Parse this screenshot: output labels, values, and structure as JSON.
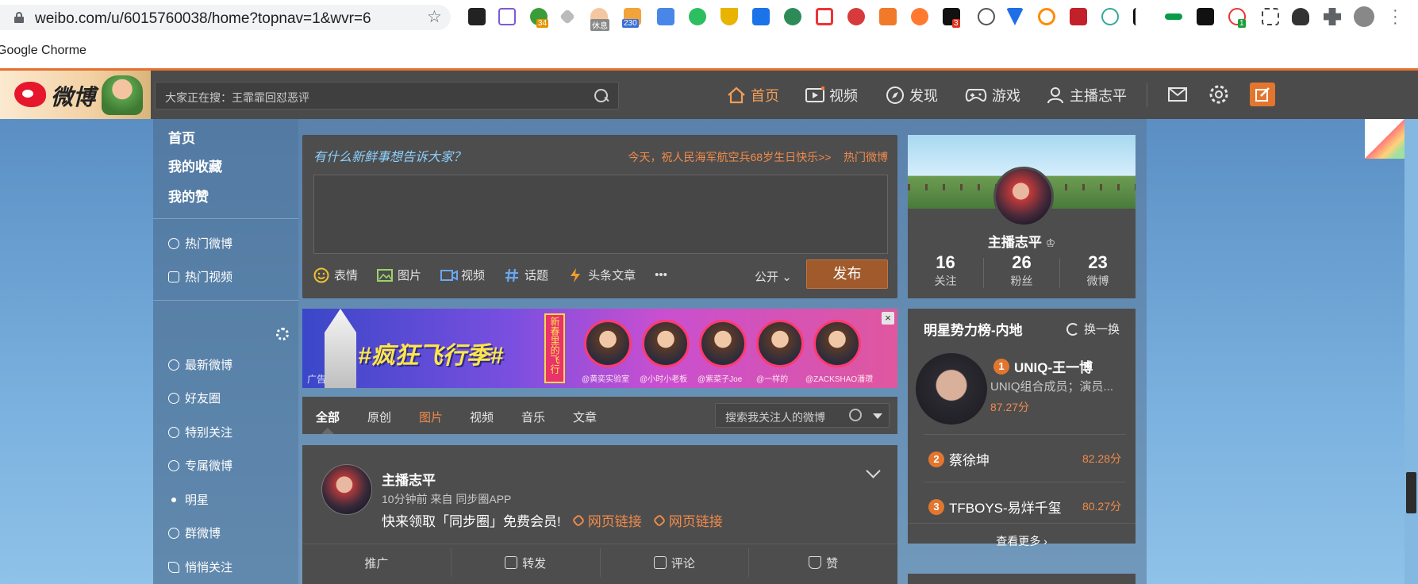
{
  "browser": {
    "url": "weibo.com/u/6015760038/home?topnav=1&wvr=6",
    "bookmark": "Google Chorme",
    "ext_badges": [
      "34",
      "休息",
      "230",
      "3",
      "1"
    ]
  },
  "nav": {
    "logo_text": "微博",
    "search_placeholder": "大家正在搜：王霏霏回怼恶评",
    "items": [
      {
        "label": "首页",
        "icon": "home-icon"
      },
      {
        "label": "视频",
        "icon": "video-icon"
      },
      {
        "label": "发现",
        "icon": "compass-icon"
      },
      {
        "label": "游戏",
        "icon": "gamepad-icon"
      },
      {
        "label": "主播志平",
        "icon": "user-icon"
      }
    ],
    "colors": {
      "bar": "#4b4b4b",
      "active": "#f29d56",
      "accent": "#e2762f"
    }
  },
  "sidebar": {
    "main_items": [
      "首页",
      "我的收藏",
      "我的赞"
    ],
    "sub_items": [
      "热门微博",
      "热门视频"
    ],
    "group_items": [
      "最新微博",
      "好友圈",
      "特别关注",
      "专属微博",
      "明星",
      "群微博",
      "悄悄关注"
    ]
  },
  "composer": {
    "title": "有什么新鲜事想告诉大家？",
    "notice": "今天，祝人民海军航空兵68岁生日快乐>>",
    "hot_link": "热门微博",
    "tools": [
      "表情",
      "图片",
      "视频",
      "话题",
      "头条文章"
    ],
    "more": "•••",
    "visibility": "公开",
    "publish": "发布"
  },
  "banner": {
    "title": "#疯狂飞行季#",
    "stripe_text": "新春里的飞行",
    "ad_label": "广告",
    "captions": [
      "@黄奕实验室",
      "@小时小老板",
      "@紫菜子Joe",
      "@一样的",
      "@ZACKSHAO潘瓒"
    ],
    "close": "×"
  },
  "feed_tabs": {
    "tabs": [
      "全部",
      "原创",
      "图片",
      "视频",
      "音乐",
      "文章"
    ],
    "search_placeholder": "搜索我关注人的微博"
  },
  "post": {
    "author": "主播志平",
    "meta": "10分钟前 来自 同步圈APP",
    "text": "快来领取「同步圈」免费会员!",
    "links": [
      "网页链接",
      "网页链接"
    ],
    "actions": [
      "推广",
      "转发",
      "评论",
      "赞"
    ]
  },
  "profile": {
    "name": "主播志平",
    "stats": [
      {
        "num": "16",
        "label": "关注"
      },
      {
        "num": "26",
        "label": "粉丝"
      },
      {
        "num": "23",
        "label": "微博"
      }
    ]
  },
  "ranking": {
    "title": "明星势力榜-内地",
    "refresh": "换一换",
    "top": {
      "rank": "1",
      "name": "UNIQ-王一博",
      "desc": "UNIQ组合成员；演员...",
      "score": "87.27分"
    },
    "rows": [
      {
        "rank": "2",
        "name": "蔡徐坤",
        "score": "82.28分"
      },
      {
        "rank": "3",
        "name": "TFBOYS-易烊千玺",
        "score": "80.27分"
      }
    ],
    "more": "查看更多 ›"
  }
}
